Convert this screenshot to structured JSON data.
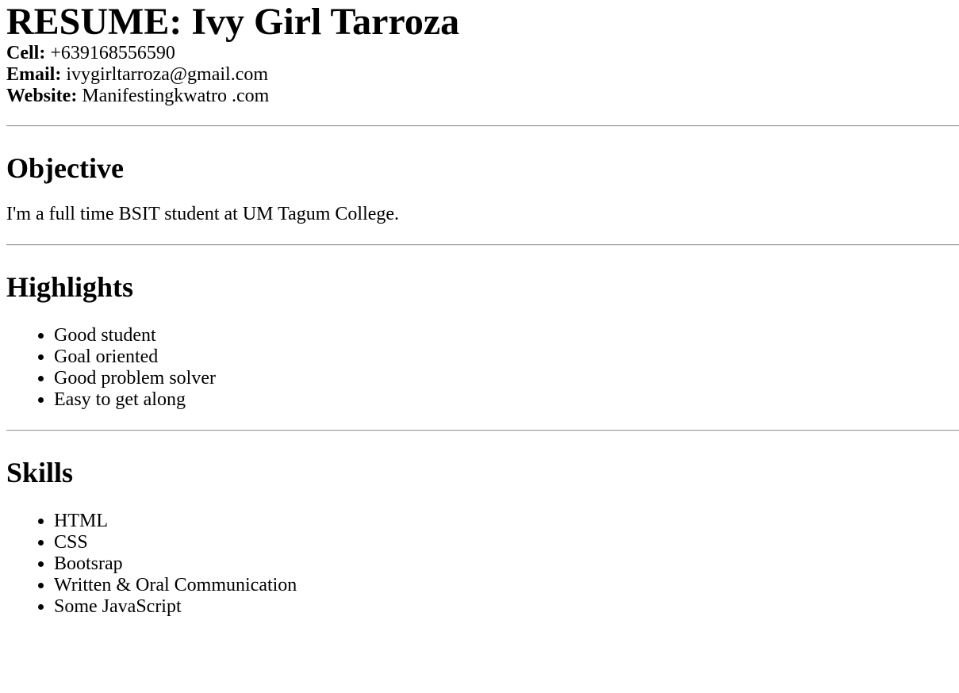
{
  "title": "RESUME: Ivy Girl Tarroza",
  "contact": {
    "cell_label": "Cell:",
    "cell_value": " +639168556590",
    "email_label": "Email:",
    "email_value": " ivygirltarroza@gmail.com",
    "website_label": "Website:",
    "website_value": " Manifestingkwatro .com"
  },
  "objective": {
    "heading": "Objective",
    "text": "I'm a full time BSIT student at UM Tagum College."
  },
  "highlights": {
    "heading": "Highlights",
    "items": [
      "Good student",
      "Goal oriented",
      "Good problem solver",
      "Easy to get along"
    ]
  },
  "skills": {
    "heading": "Skills",
    "items": [
      "HTML",
      "CSS",
      "Bootsrap",
      "Written & Oral Communication",
      "Some JavaScript"
    ]
  }
}
